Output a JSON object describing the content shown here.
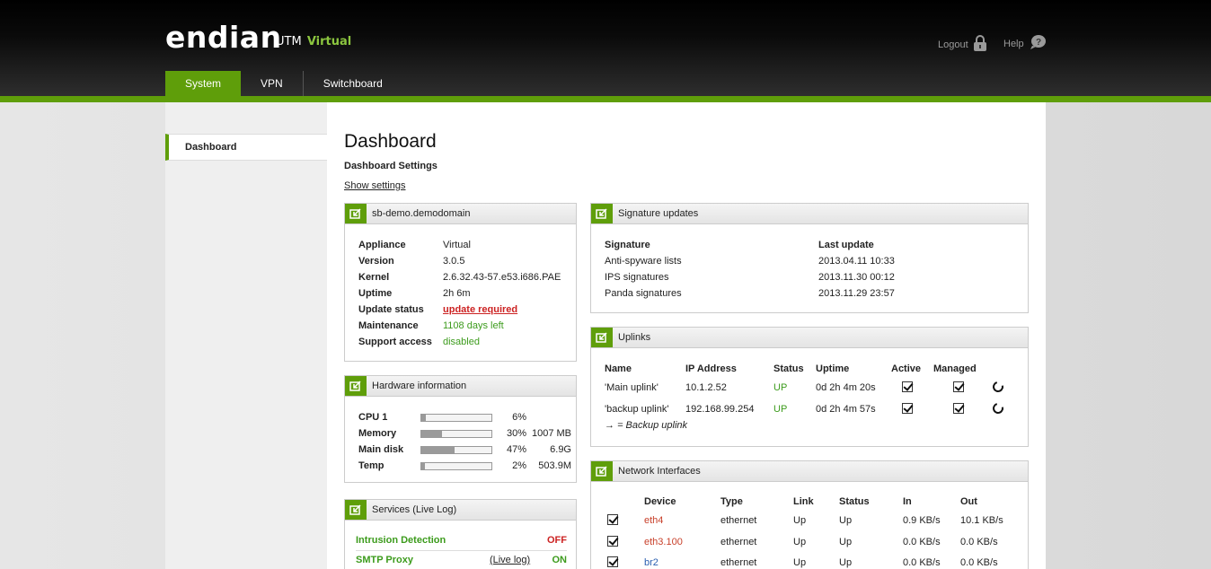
{
  "header": {
    "logo": "endian",
    "product_prefix": "UTM",
    "product_name": "Virtual",
    "logout_label": "Logout",
    "help_label": "Help"
  },
  "nav": {
    "tabs": [
      "System",
      "VPN",
      "Switchboard"
    ],
    "active": "System"
  },
  "sidebar": {
    "items": [
      "Dashboard"
    ]
  },
  "page": {
    "title": "Dashboard",
    "settings_title": "Dashboard Settings",
    "show_settings": "Show settings"
  },
  "appliance_panel": {
    "title": "sb-demo.demodomain",
    "rows": [
      {
        "label": "Appliance",
        "value": "Virtual"
      },
      {
        "label": "Version",
        "value": "3.0.5"
      },
      {
        "label": "Kernel",
        "value": "2.6.32.43-57.e53.i686.PAE"
      },
      {
        "label": "Uptime",
        "value": "2h 6m"
      },
      {
        "label": "Update status",
        "value": "update required"
      },
      {
        "label": "Maintenance",
        "value": "1108 days left"
      },
      {
        "label": "Support access",
        "value": "disabled"
      }
    ]
  },
  "hardware_panel": {
    "title": "Hardware information",
    "rows": [
      {
        "label": "CPU 1",
        "percent": "6%",
        "fill": 0.06,
        "extra": ""
      },
      {
        "label": "Memory",
        "percent": "30%",
        "fill": 0.3,
        "extra": "1007 MB"
      },
      {
        "label": "Main disk",
        "percent": "47%",
        "fill": 0.47,
        "extra": "6.9G"
      },
      {
        "label": "Temp",
        "percent": "2%",
        "fill": 0.02,
        "extra": "503.9M"
      }
    ]
  },
  "services_panel": {
    "title": "Services",
    "title_link": "(Live Log)",
    "rows": [
      {
        "name": "Intrusion Detection",
        "log": "",
        "state": "OFF"
      },
      {
        "name": "SMTP Proxy",
        "log": "(Live log)",
        "state": "ON"
      }
    ]
  },
  "signature_panel": {
    "title": "Signature updates",
    "headers": [
      "Signature",
      "Last update"
    ],
    "rows": [
      [
        "Anti-spyware lists",
        "2013.04.11 10:33"
      ],
      [
        "IPS signatures",
        "2013.11.30 00:12"
      ],
      [
        "Panda signatures",
        "2013.11.29 23:57"
      ]
    ]
  },
  "uplinks_panel": {
    "title": "Uplinks",
    "headers": [
      "Name",
      "IP Address",
      "Status",
      "Uptime",
      "Active",
      "Managed"
    ],
    "rows": [
      {
        "name": "'Main uplink'",
        "ip": "10.1.2.52",
        "status": "UP",
        "uptime": "0d 2h 4m 20s"
      },
      {
        "name": "'backup uplink'",
        "ip": "192.168.99.254",
        "status": "UP",
        "uptime": "0d 2h 4m 57s"
      }
    ],
    "legend_arrow": "→",
    "legend_text": "= Backup uplink"
  },
  "network_panel": {
    "title": "Network Interfaces",
    "headers": [
      "Device",
      "Type",
      "Link",
      "Status",
      "In",
      "Out"
    ],
    "rows": [
      {
        "device": "eth4",
        "type": "ethernet",
        "link": "Up",
        "status": "Up",
        "in": "0.9 KB/s",
        "out": "10.1 KB/s",
        "color": "#c8402a"
      },
      {
        "device": "eth3.100",
        "type": "ethernet",
        "link": "Up",
        "status": "Up",
        "in": "0.0 KB/s",
        "out": "0.0 KB/s",
        "color": "#c8402a"
      },
      {
        "device": "br2",
        "type": "ethernet",
        "link": "Up",
        "status": "Up",
        "in": "0.0 KB/s",
        "out": "0.0 KB/s",
        "color": "#2a5fb0"
      }
    ]
  },
  "colors": {
    "accent": "#5f9e0a",
    "ok": "#3c9b1c",
    "alert": "#cc2222"
  }
}
